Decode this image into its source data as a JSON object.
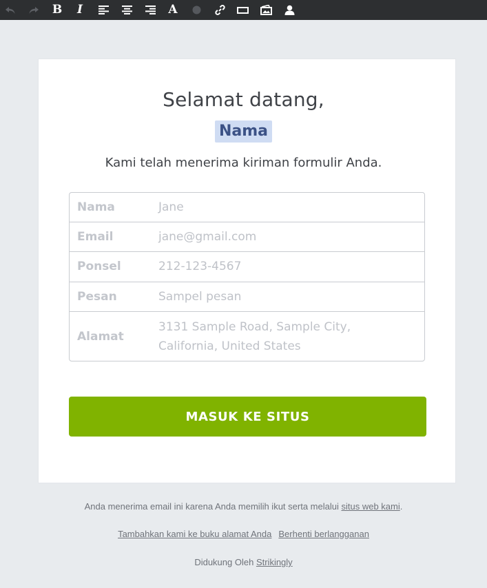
{
  "toolbar": {
    "buttons": [
      {
        "name": "undo-icon",
        "enabled": false
      },
      {
        "name": "redo-icon",
        "enabled": false
      },
      {
        "name": "bold-icon",
        "label": "B"
      },
      {
        "name": "italic-icon",
        "label": "I"
      },
      {
        "name": "align-left-icon"
      },
      {
        "name": "align-center-icon"
      },
      {
        "name": "align-right-icon"
      },
      {
        "name": "font-color-icon",
        "label": "A"
      },
      {
        "name": "color-dot-icon"
      },
      {
        "name": "link-icon"
      },
      {
        "name": "button-icon"
      },
      {
        "name": "image-icon"
      },
      {
        "name": "user-icon"
      }
    ],
    "colors": {
      "background": "#2d2f31",
      "icon": "#ffffff",
      "icon_disabled": "#5e6166"
    }
  },
  "email": {
    "greeting": "Selamat datang,",
    "name_placeholder": "Nama",
    "message": "Kami telah menerima kiriman formulir Anda.",
    "fields": [
      {
        "label": "Nama",
        "value": "Jane"
      },
      {
        "label": "Email",
        "value": "jane@gmail.com"
      },
      {
        "label": "Ponsel",
        "value": "212-123-4567"
      },
      {
        "label": "Pesan",
        "value": "Sampel pesan"
      },
      {
        "label": "Alamat",
        "value": "3131 Sample Road, Sample City, California, United States"
      }
    ],
    "cta_label": "MASUK KE SITUS",
    "colors": {
      "cta": "#80b300",
      "name_chip_bg": "#cfdcf3",
      "name_chip_text": "#3c5286"
    }
  },
  "footer": {
    "notice_text": "Anda menerima email ini karena Anda memilih ikut serta melalui",
    "notice_link": "situs web kami",
    "notice_end": ".",
    "add_address_link": "Tambahkan kami ke buku alamat Anda",
    "unsubscribe_link": "Berhenti berlangganan",
    "powered_by_text": "Didukung Oleh",
    "powered_by_link": "Strikingly"
  }
}
